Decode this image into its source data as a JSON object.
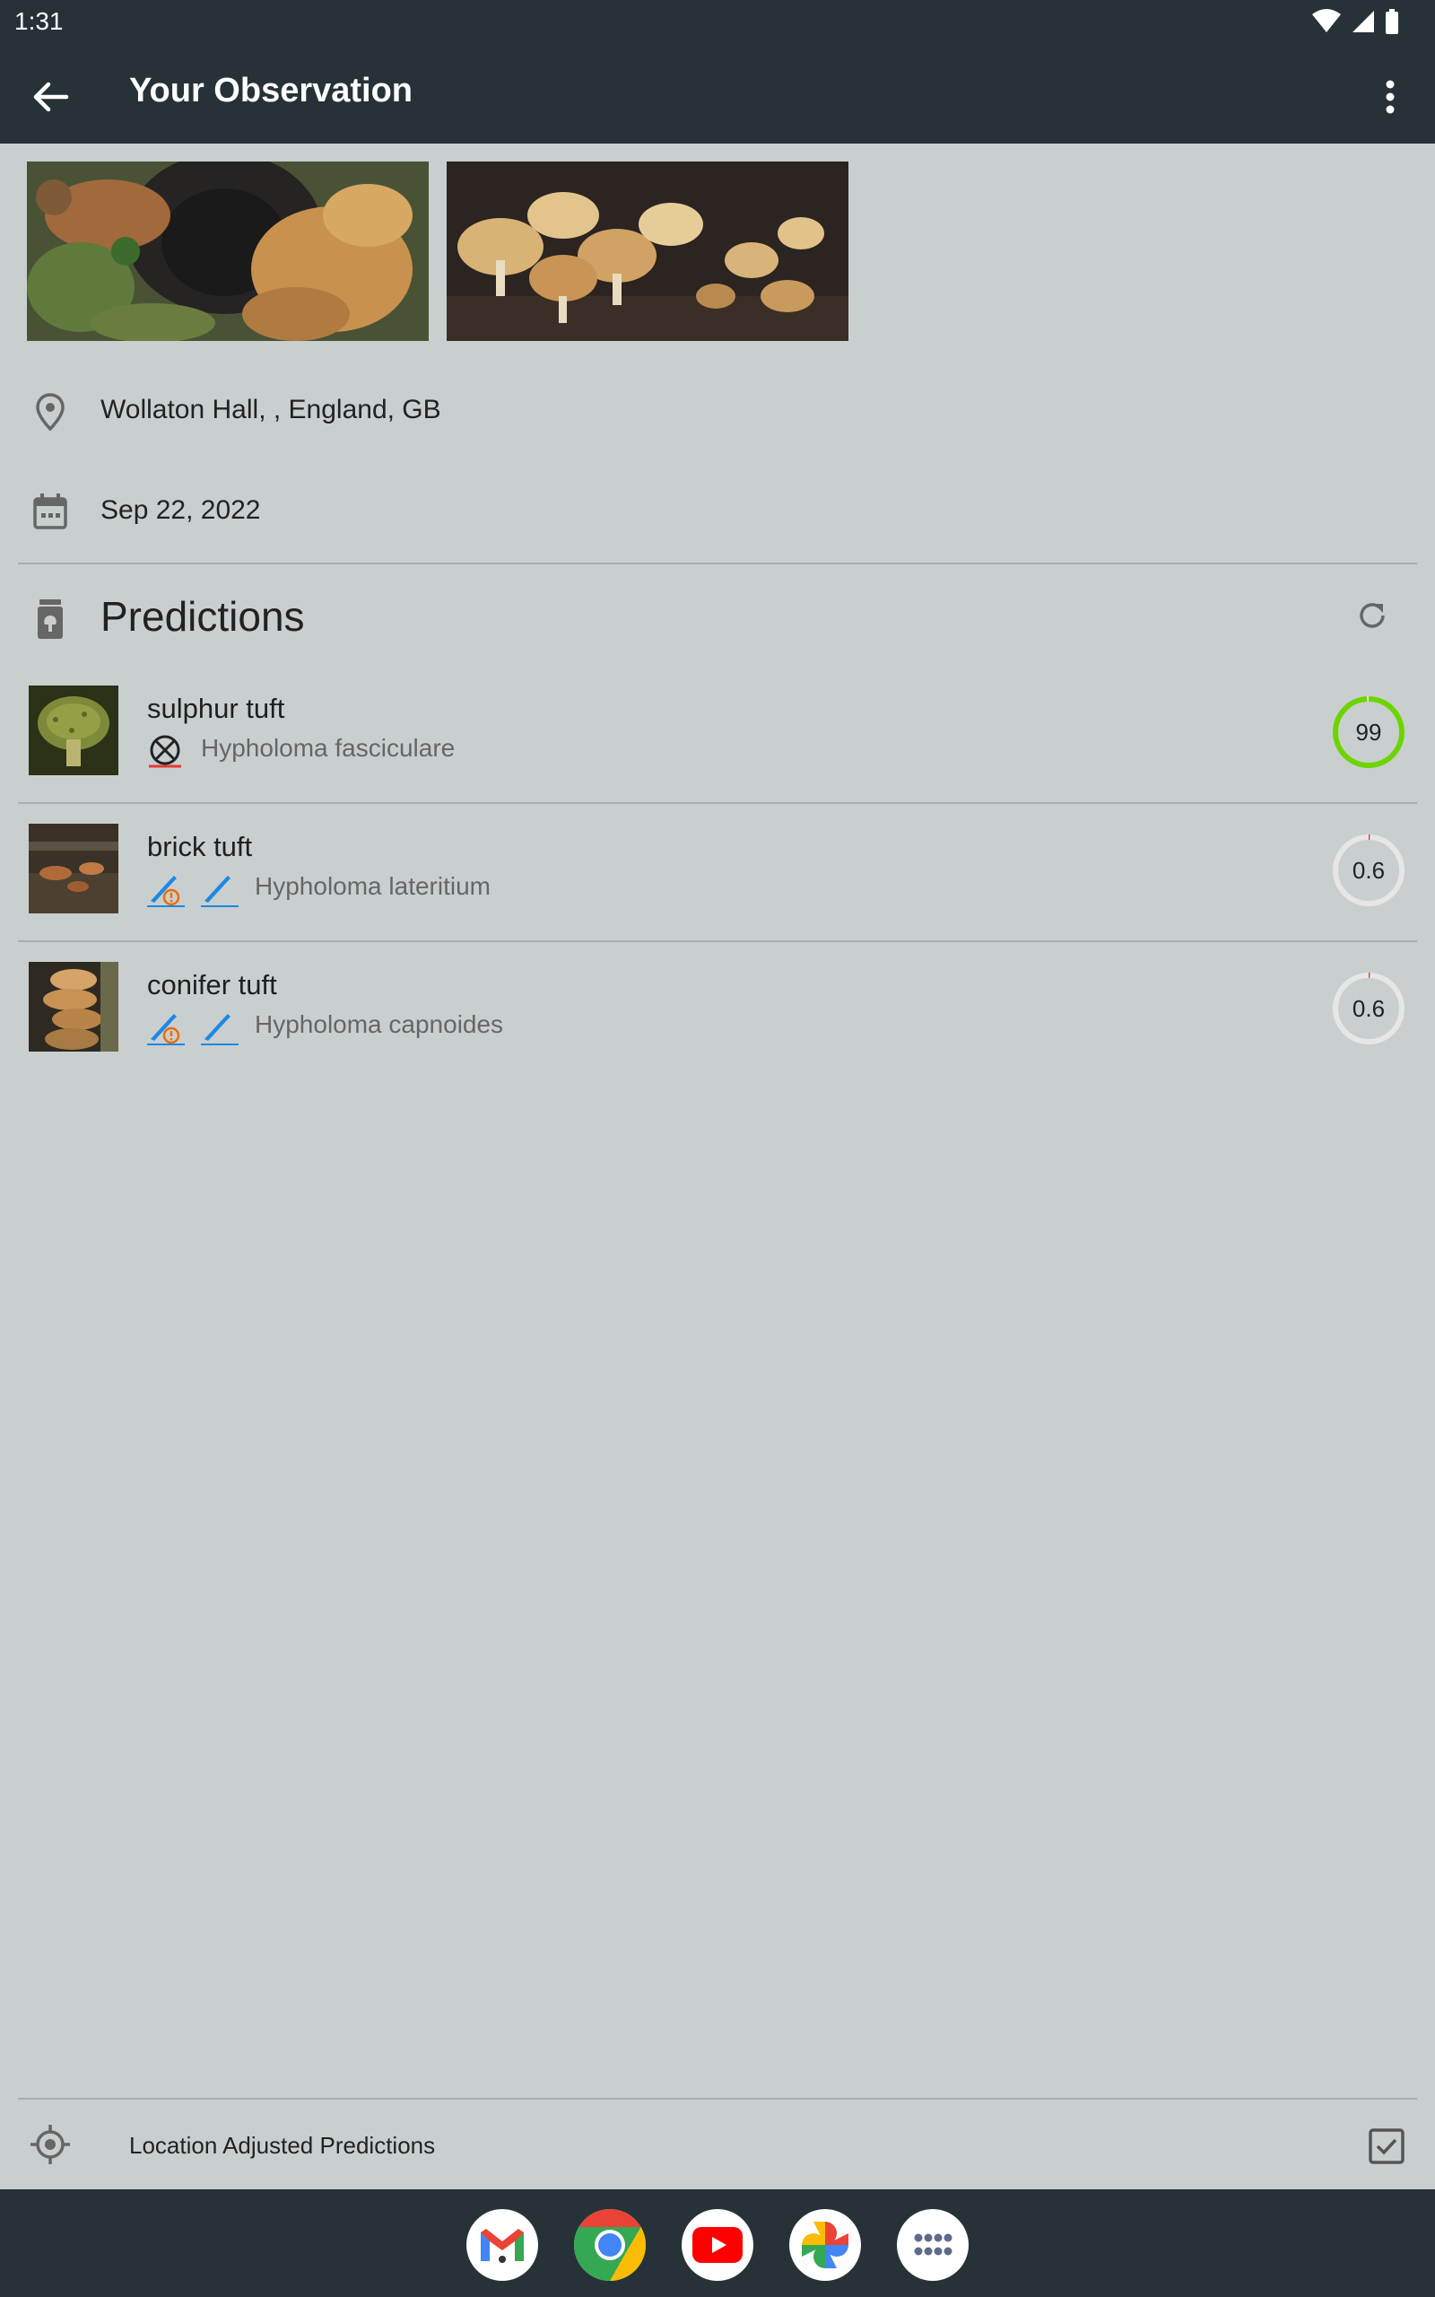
{
  "status": {
    "time": "1:31"
  },
  "appbar": {
    "title": "Your Observation"
  },
  "observation": {
    "location": "Wollaton Hall, , England, GB",
    "date": "Sep 22, 2022"
  },
  "predictions": {
    "title": "Predictions",
    "items": [
      {
        "common": "sulphur tuft",
        "scientific": "Hypholoma fasciculare",
        "score": "99",
        "score_fraction": 0.99,
        "score_color": "#6dd400",
        "badges": [
          "poisonous-icon"
        ]
      },
      {
        "common": "brick tuft",
        "scientific": "Hypholoma lateritium",
        "score": "0.6",
        "score_fraction": 0.006,
        "score_color": "#e53935",
        "badges": [
          "edible-caution-icon",
          "edible-icon"
        ]
      },
      {
        "common": "conifer tuft",
        "scientific": "Hypholoma capnoides",
        "score": "0.6",
        "score_fraction": 0.006,
        "score_color": "#e53935",
        "badges": [
          "edible-caution-icon",
          "edible-icon"
        ]
      }
    ]
  },
  "location_bar": {
    "label": "Location Adjusted Predictions",
    "checked": true
  },
  "dock": {
    "apps": [
      "gmail-icon",
      "chrome-icon",
      "youtube-icon",
      "photos-icon",
      "app-drawer-icon"
    ]
  },
  "colors": {
    "appbar": "#263238",
    "background": "#c9cfcf",
    "accent_green": "#6dd400"
  }
}
